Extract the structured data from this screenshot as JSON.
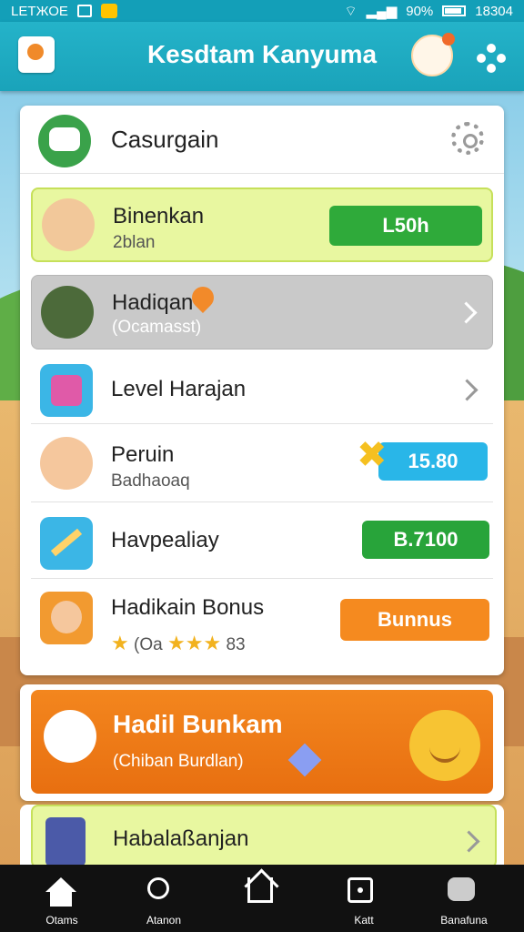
{
  "status_bar": {
    "carrier": "LЕТЖОЕ",
    "battery": "90%",
    "time": "18304"
  },
  "header": {
    "title": "Kesdtam Kanyuma"
  },
  "card": {
    "title": "Casurgain",
    "rows": [
      {
        "name": "Binenkan",
        "sub": "2blan",
        "action": "L50h"
      },
      {
        "name": "Hadiqan",
        "sub": "(Ocamasst)"
      },
      {
        "name": "Level Harajan"
      },
      {
        "name": "Peruin",
        "sub": "Badhaoaq",
        "action": "15.80"
      },
      {
        "name": "Havpealiay",
        "action": "B.7100"
      },
      {
        "name": "Hadikain Bonus",
        "sub": "(Oa",
        "rating": "83",
        "rating_stars": 4,
        "action": "Bunnus"
      }
    ]
  },
  "promo": {
    "title": "Hadil Bunkam",
    "sub": "(Chiban Burdlan)"
  },
  "next_item": {
    "title": "Habalaßanjan"
  },
  "tabs": [
    {
      "label": "Otams",
      "icon": "home-icon"
    },
    {
      "label": "Atanon",
      "icon": "search-icon"
    },
    {
      "label": "",
      "icon": "house-outline-icon"
    },
    {
      "label": "Katt",
      "icon": "box-icon"
    },
    {
      "label": "Banafuna",
      "icon": "robot-icon"
    }
  ],
  "colors": {
    "header": "#1aa3ba",
    "green": "#2faa3a",
    "blue": "#29b6e8",
    "orange": "#f58a1f"
  }
}
